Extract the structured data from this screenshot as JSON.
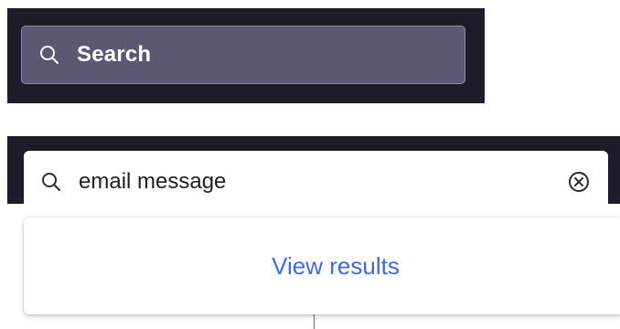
{
  "collapsed_search": {
    "label": "Search",
    "icon": "search-icon",
    "colors": {
      "bar": "#1e1c2b",
      "field": "#5b5873",
      "border": "#8f8ca6",
      "text": "#ffffff"
    }
  },
  "expanded_search": {
    "value": "email message",
    "icon": "search-icon",
    "clear_icon": "clear-circle-x-icon",
    "colors": {
      "bar": "#1e1c2b",
      "field": "#ffffff",
      "text": "#1f1f1f"
    }
  },
  "dropdown": {
    "view_results_label": "View results",
    "link_color": "#3d6ce0"
  }
}
